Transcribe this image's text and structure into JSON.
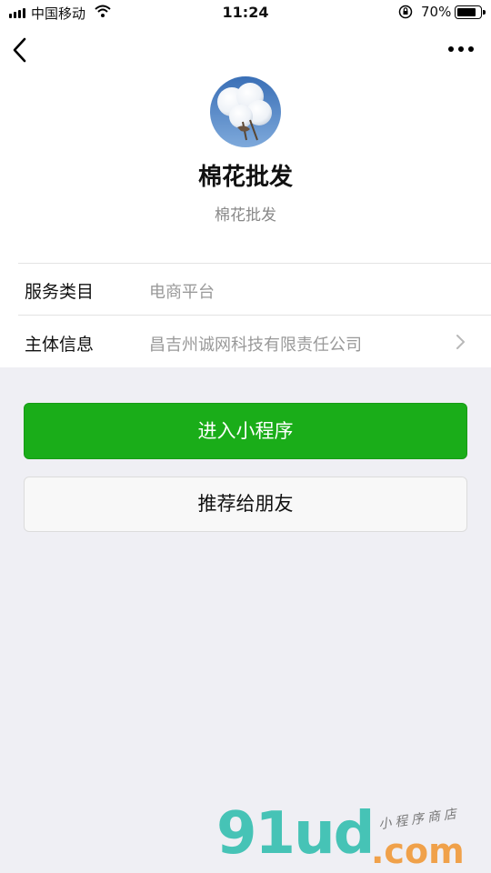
{
  "status_bar": {
    "carrier": "中国移动",
    "time": "11:24",
    "battery_percent": "70%",
    "battery_level": 0.7,
    "icons": [
      "signal-icon",
      "wifi-icon",
      "orientation-lock-icon",
      "battery-icon"
    ]
  },
  "nav": {
    "back_icon": "chevron-left-icon",
    "more_icon": "more-dots-icon"
  },
  "profile": {
    "avatar": "cotton-flower-image",
    "name": "棉花批发",
    "description": "棉花批发"
  },
  "info": {
    "rows": [
      {
        "label": "服务类目",
        "value": "电商平台"
      },
      {
        "label": "主体信息",
        "value": "昌吉州诚网科技有限责任公司"
      }
    ]
  },
  "actions": {
    "primary_label": "进入小程序",
    "secondary_label": "推荐给朋友",
    "primary_color": "#1aad19"
  },
  "watermark": {
    "brand": "91ud",
    "domain": ".com",
    "tagline": "小程序商店"
  }
}
